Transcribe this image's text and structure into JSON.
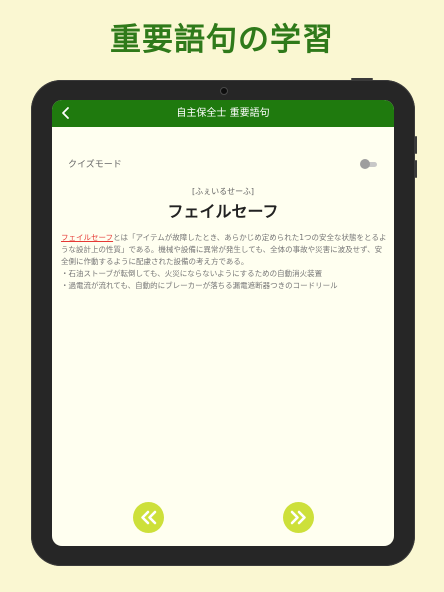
{
  "headline": "重要語句の学習",
  "header": {
    "title": "自主保全士 重要語句"
  },
  "quiz_mode": {
    "label": "クイズモード",
    "enabled": false
  },
  "term": {
    "reading": "[ふぇいるせーふ]",
    "title": "フェイルセーフ",
    "link_text": "フェイルセーフ",
    "definition_rest": "とは「アイテムが故障したとき、あらかじめ定められた1つの安全な状態をとるような設計上の性質」である。機械や設備に異常が発生しても、全体の事故や災害に波及せず、安全側に作動するように配慮された設備の考え方である。",
    "examples": [
      "・石油ストーブが転倒しても、火災にならないようにするための自動消火装置",
      "・過電流が流れても、自動的にブレーカーが落ちる漏電遮断器つきのコードリール"
    ]
  },
  "colors": {
    "page_background": "#faf7d2",
    "headline": "#2f7a1a",
    "nav_bar": "#1f7a0e",
    "screen_background": "#fffff0",
    "link": "#e53935",
    "nav_buttons": "#cde03a"
  },
  "icons": {
    "back": "chevron-left-icon",
    "previous": "double-chevron-left-icon",
    "next": "double-chevron-right-icon"
  }
}
